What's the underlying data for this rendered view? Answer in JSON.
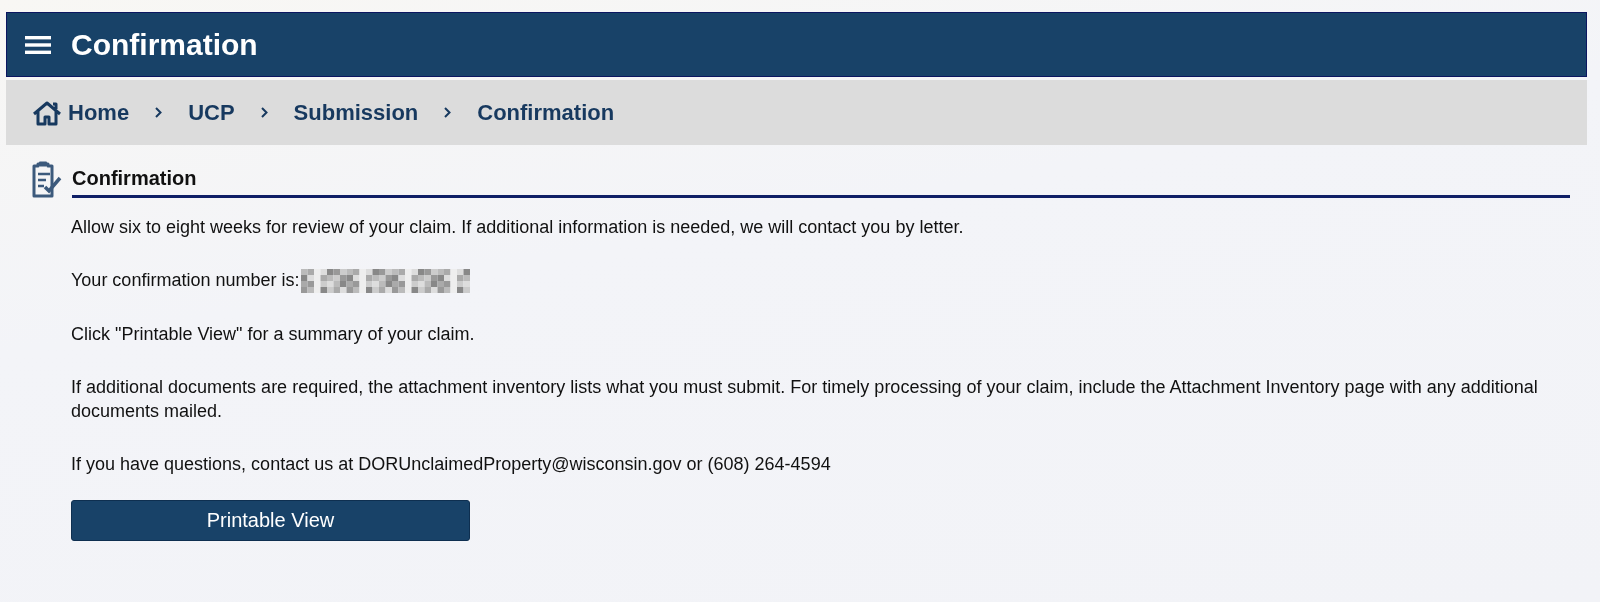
{
  "header": {
    "title": "Confirmation"
  },
  "breadcrumb": [
    {
      "label": "Home",
      "kind": "home"
    },
    {
      "label": "UCP",
      "kind": "link"
    },
    {
      "label": "Submission",
      "kind": "link"
    },
    {
      "label": "Confirmation",
      "kind": "link"
    }
  ],
  "section": {
    "title": "Confirmation"
  },
  "paragraphs": [
    {
      "text": "Allow six to eight weeks for review of your claim. If additional information is needed, we will contact you by letter.",
      "redacted": false
    },
    {
      "text": "Your confirmation number is:",
      "redacted": true
    },
    {
      "text": "Click \"Printable View\" for a summary of your claim.",
      "redacted": false
    },
    {
      "text": "If additional documents are required, the attachment inventory lists what you must submit. For timely processing of your claim, include the Attachment Inventory page with any additional documents mailed.",
      "redacted": false
    },
    {
      "text": "If you have questions, contact us at DORUnclaimedProperty@wisconsin.gov or (608) 264-4594",
      "redacted": false
    }
  ],
  "button": {
    "label": "Printable View"
  }
}
